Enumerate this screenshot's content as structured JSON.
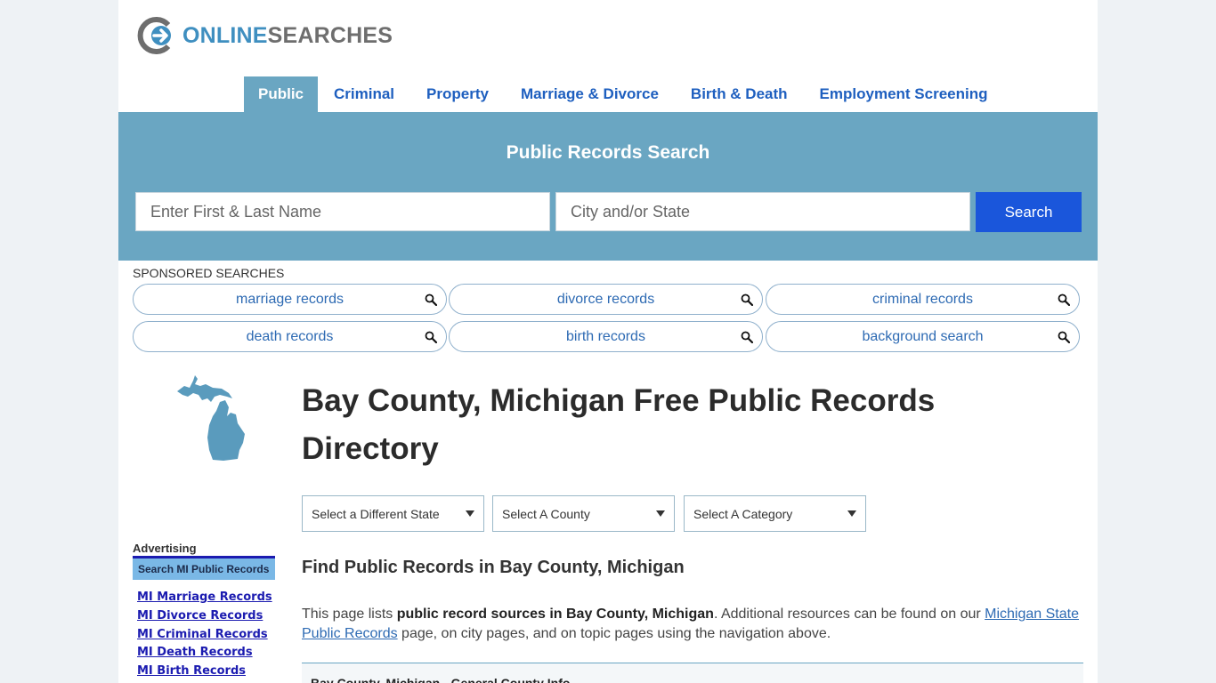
{
  "logo": {
    "online": "ONLINE",
    "searches": "SEARCHES"
  },
  "nav": {
    "items": [
      {
        "label": "Public"
      },
      {
        "label": "Criminal"
      },
      {
        "label": "Property"
      },
      {
        "label": "Marriage & Divorce"
      },
      {
        "label": "Birth & Death"
      },
      {
        "label": "Employment Screening"
      }
    ],
    "active": "Public"
  },
  "search": {
    "title": "Public Records Search",
    "name_placeholder": "Enter First & Last Name",
    "location_placeholder": "City and/or State",
    "button_label": "Search"
  },
  "sponsored": {
    "label": "SPONSORED SEARCHES",
    "items": [
      "marriage records",
      "divorce records",
      "criminal records",
      "death records",
      "birth records",
      "background search"
    ]
  },
  "sidebar": {
    "advertising_label": "Advertising",
    "header": "Search MI Public Records",
    "links": [
      "MI Marriage Records",
      "MI Divorce Records",
      "MI Criminal Records",
      "MI Death Records",
      "MI Birth Records"
    ]
  },
  "main": {
    "title": "Bay County, Michigan Free Public Records Directory",
    "selects": [
      "Select a Different State",
      "Select A County",
      "Select A Category"
    ],
    "subheading": "Find Public Records in Bay County, Michigan",
    "para_start": "This page lists ",
    "para_bold": "public record sources in Bay County, Michigan",
    "para_mid": ". Additional resources can be found on our ",
    "para_link": "Michigan State Public Records",
    "para_end": " page, on city pages, and on topic pages using the navigation above.",
    "info_bar": "Bay County, Michigan - General County Info"
  },
  "colors": {
    "accent": "#6aa6c2",
    "button": "#1a56db",
    "link": "#2d6ab3"
  }
}
